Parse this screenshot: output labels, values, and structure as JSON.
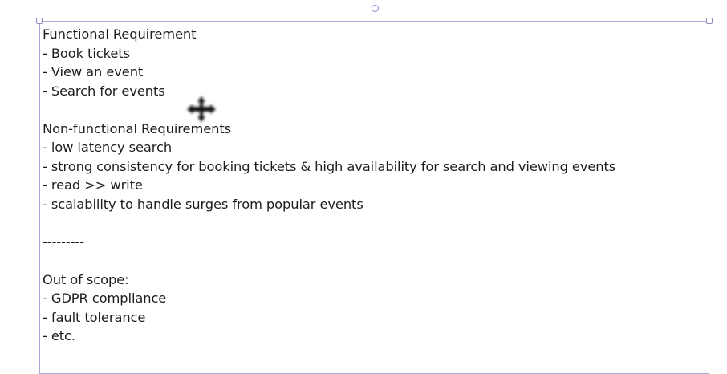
{
  "canvas": {
    "lines": [
      "Functional Requirement",
      "- Book tickets",
      "- View an event",
      "- Search for events",
      "",
      "Non-functional Requirements",
      "- low latency search",
      "- strong consistency for booking tickets & high availability for search and viewing events",
      "- read >> write",
      "- scalability to handle surges from popular events",
      "",
      "---------",
      "",
      "Out of scope:",
      "- GDPR compliance",
      "- fault tolerance",
      "- etc."
    ],
    "selection_color": "#a9a8d6",
    "cursor_icon": "move-cursor-icon"
  }
}
